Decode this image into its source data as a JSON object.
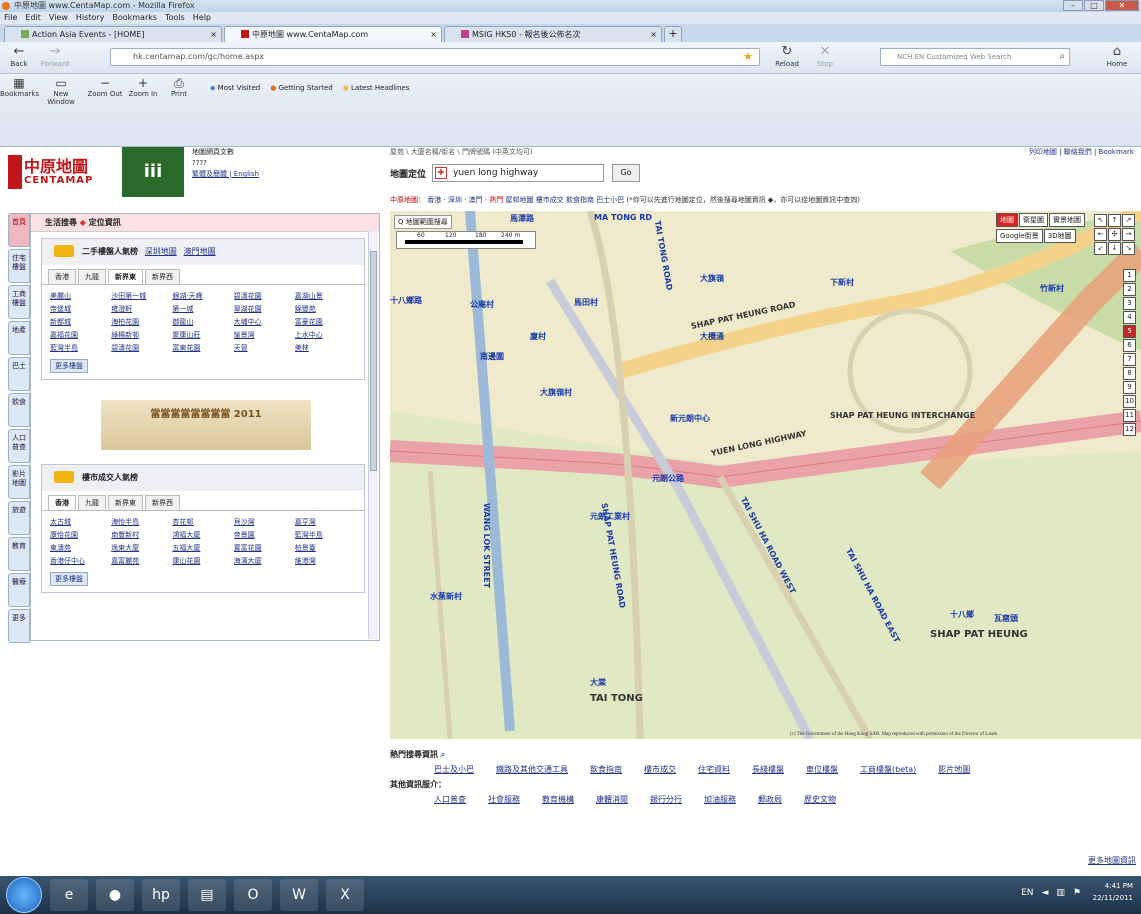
{
  "window": {
    "title": "中原地圖 www.CentaMap.com - Mozilla Firefox"
  },
  "menu": [
    "File",
    "Edit",
    "View",
    "History",
    "Bookmarks",
    "Tools",
    "Help"
  ],
  "tabs": [
    {
      "label": "Action Asia Events - [HOME]"
    },
    {
      "label": "中原地圖 www.CentaMap.com"
    },
    {
      "label": "MSIG HK50 - 報名後公佈名次"
    }
  ],
  "nav": {
    "back": "Back",
    "forward": "Forward",
    "reload": "Reload",
    "stop": "Stop",
    "home": "Home",
    "url": "hk.centamap.com/gc/home.aspx",
    "search_placeholder": "NCH EN Customized Web Search"
  },
  "toolbar": {
    "buttons": [
      "Bookmarks",
      "New Window",
      "Zoom Out",
      "Zoom In",
      "Print"
    ],
    "bookmarks": [
      "Most Visited",
      "Getting Started",
      "Latest Headlines"
    ]
  },
  "page": {
    "logo_cn": "中原地圖",
    "logo_en": "CENTAMAP",
    "header_links": [
      "地圖網頁文數",
      "????",
      "繁體及簡體 | English"
    ],
    "side_tabs": [
      "首頁",
      "住宅樓盤",
      "工商樓盤",
      "地產",
      "巴士",
      "飲食",
      "人口普查",
      "影片地圖",
      "旅遊",
      "教育",
      "醫療",
      "更多"
    ],
    "panel_title": "生活搜尋",
    "panel_sub": "定位資訊",
    "box1": {
      "title": "二手樓盤人氣榜",
      "links": [
        "深圳地圖",
        "澳門地圖"
      ],
      "tabs": [
        "香港",
        "九龍",
        "新界東",
        "新界西"
      ],
      "items": [
        "美麗山",
        "沙田第一城",
        "銀湖·天峰",
        "碧濤花園",
        "嘉湖山景",
        "帝堡城",
        "雍澄軒",
        "第一城",
        "翠湖花園",
        "錦豐苑",
        "新都城",
        "海柏花園",
        "御龍山",
        "大埔中心",
        "富豪花園",
        "嘉福花園",
        "綠楊新邨",
        "聚康山莊",
        "愉景灣",
        "上水中心",
        "藍灣半島",
        "碧濤花園",
        "富東花園",
        "天晉",
        "美林"
      ],
      "more": "更多樓盤"
    },
    "banner": "當當當當當當當當 2011",
    "box2": {
      "title": "樓市成交人氣榜",
      "tabs": [
        "香港",
        "九龍",
        "新界東",
        "新界西"
      ],
      "items": [
        "太古城",
        "海怡半島",
        "杏花邨",
        "貝沙灣",
        "嘉亨灣",
        "康怡花園",
        "南豐新村",
        "鴻福大廈",
        "帝景園",
        "藍灣半島",
        "東濤苑",
        "逸東大廈",
        "五福大廈",
        "置富花園",
        "柏景臺",
        "香港仔中心",
        "嘉富麗苑",
        "康山花園",
        "海濱大廈",
        "維港灣"
      ],
      "more": "更多樓盤"
    },
    "map_header": {
      "breadcrumb": "屋苑 \\ 大廈名稱/街名 \\ 門牌號碼 (中英文均可)",
      "top_right": "列印地圖 | 聯絡我們 | Bookmark",
      "loc_label": "地圖定位",
      "loc_value": "yuen long highway",
      "go": "Go",
      "links_prefix": "中原地圖：",
      "links": [
        "香港",
        "深圳",
        "澳門",
        "熱門",
        "屋邨地圖",
        "樓市成交",
        "飲食指南",
        "巴士小巴"
      ],
      "links_note": "(*你可以先進行地圖定位，然後搜尋地圖資訊 ◆，亦可以從地圖資訊中查詢)"
    },
    "map": {
      "search_area": "Q 地圖範圍搜尋",
      "scale_ticks": [
        "60",
        "120",
        "180",
        "240 m"
      ],
      "map_types": [
        "地圖",
        "衛星圖",
        "實景地圖",
        "Google街景",
        "3D地圖"
      ],
      "zoom_levels": [
        "1",
        "2",
        "3",
        "4",
        "5",
        "6",
        "7",
        "8",
        "9",
        "10",
        "11",
        "12"
      ],
      "zoom_active": "5",
      "labels": [
        {
          "t": "馬潭路",
          "n": "label-ma-tong-rd"
        },
        {
          "t": "MA TONG RD",
          "n": "label-ma-tong-rd-en"
        },
        {
          "t": "十八鄉路",
          "n": "label-shap-pat-heung-rd"
        },
        {
          "t": "SHAP PAT HEUNG ROAD",
          "n": "label-shap-pat-heung-road"
        },
        {
          "t": "SHAP PAT HEUNG INTERCHANGE",
          "n": "label-interchange"
        },
        {
          "t": "YUEN LONG HIGHWAY",
          "n": "label-yuen-long-highway"
        },
        {
          "t": "元朗公路",
          "n": "label-yuen-long-highway-cn"
        },
        {
          "t": "SHAP PAT HEUNG",
          "n": "label-shap-pat-heung"
        },
        {
          "t": "十八鄉",
          "n": "label-shap-pat-heung-cn"
        },
        {
          "t": "大棠",
          "n": "label-tai-tong-cn"
        },
        {
          "t": "TAI TONG",
          "n": "label-tai-tong"
        },
        {
          "t": "TAI TONG ROAD",
          "n": "label-tai-tong-road"
        },
        {
          "t": "SHAP PAT HEUNG ROAD",
          "n": "label-sph-road-2"
        },
        {
          "t": "TAI SHU HA ROAD WEST",
          "n": "label-tai-shu-ha-west"
        },
        {
          "t": "TAI SHU HA ROAD EAST",
          "n": "label-tai-shu-ha-east"
        },
        {
          "t": "WANG LOK STREET",
          "n": "label-wang-lok"
        },
        {
          "t": "大旗嶺",
          "n": "label-tai-kei-leng"
        },
        {
          "t": "公庵村",
          "n": "label-kung-um"
        },
        {
          "t": "大欖涌",
          "n": "label-tai-lam"
        },
        {
          "t": "下新村",
          "n": "label-ha-san-tsuen"
        },
        {
          "t": "竹新村",
          "n": "label-chuk-san"
        },
        {
          "t": "元朗工業村",
          "n": "label-yuen-long-industrial"
        },
        {
          "t": "水蕉新村",
          "n": "label-shui-tsiu"
        },
        {
          "t": "南邊圍",
          "n": "label-nam-pin-wai"
        },
        {
          "t": "廈村",
          "n": "label-ha-tsuen"
        },
        {
          "t": "大旗嶺村",
          "n": "label-tai-kei-leng-tsuen"
        },
        {
          "t": "馬田村",
          "n": "label-ma-tin"
        },
        {
          "t": "新元朗中心",
          "n": "label-sun-yuen-long"
        },
        {
          "t": "瓦窰頭",
          "n": "label-ngo-yiu-tau"
        }
      ],
      "copyright": "(c) The Government of the Hong Kong SAR. Map reproduced with permission of the Director of Lands"
    },
    "footer": {
      "hot_title": "熱門搜尋資訊",
      "hot_links": [
        "巴士及小巴",
        "鐵路及其他交通工具",
        "飲食指南",
        "樓市成交",
        "住宅資料",
        "長綫樓盤",
        "車位樓盤",
        "工商樓盤(beta)",
        "影片地圖"
      ],
      "other_title": "其他資訊服介：",
      "other_links": [
        "人口普查",
        "社會服務",
        "教育機構",
        "康體消閒",
        "銀行分行",
        "加油服務",
        "郵政局",
        "歷史文物"
      ],
      "more": "更多地圖資訊"
    }
  },
  "taskbar": {
    "apps": [
      "ie",
      "firefox",
      "hp",
      "explorer",
      "outlook",
      "word",
      "excel"
    ],
    "lang": "EN",
    "time": "4:41 PM",
    "date": "22/11/2011"
  }
}
